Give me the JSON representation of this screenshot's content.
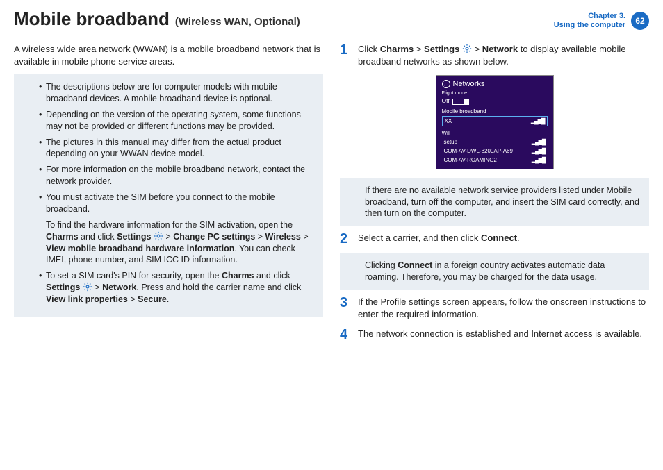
{
  "header": {
    "title_main": "Mobile broadband",
    "title_sub": "(Wireless WAN, Optional)",
    "chapter_line1": "Chapter 3.",
    "chapter_line2": "Using the computer",
    "page": "62"
  },
  "left": {
    "intro": "A wireless wide area network (WWAN) is a mobile broadband network that is available in mobile phone service areas.",
    "notes": {
      "b1": "The descriptions below are for computer models with mobile broadband devices. A mobile broadband device is optional.",
      "b2": "Depending on the version of the operating system, some functions may not be provided or different functions may be provided.",
      "b3": "The pictures in this manual may differ from the actual product depending on your WWAN device model.",
      "b4": "For more information on the mobile broadband network, contact the network provider.",
      "b5": "You must activate the SIM before you connect to the mobile broadband.",
      "sub1_a": "To find the hardware information for the SIM activation, open the ",
      "sub1_charms": "Charms",
      "sub1_andclick": " and click ",
      "sub1_settings": "Settings",
      "sub1_gt1": " > ",
      "sub1_change": "Change PC settings",
      "sub1_gt2": " > ",
      "sub1_wireless": "Wireless",
      "sub1_gt3": " > ",
      "sub1_view": "View mobile broadband hardware information",
      "sub1_tail": ". You can check IMEI, phone number, and SIM ICC ID information.",
      "b6_a": "To set a SIM card's PIN for security, open the ",
      "b6_charms": "Charms",
      "b6_andclick": " and click ",
      "b6_settings": "Settings",
      "b6_gt1": " > ",
      "b6_network": "Network",
      "b6_tail": ". Press and hold the carrier name and click ",
      "b6_view": "View link properties",
      "b6_gt2": " > ",
      "b6_secure": "Secure",
      "b6_dot": "."
    }
  },
  "right": {
    "step1": {
      "num": "1",
      "a": "Click ",
      "charms": "Charms",
      "gt1": " > ",
      "settings": "Settings",
      "gt2": " > ",
      "network": "Network",
      "tail": " to display available mobile broadband networks as shown below."
    },
    "screenshot": {
      "title": "Networks",
      "flight": "Flight mode",
      "off": "Off",
      "mb": "Mobile broadband",
      "xx": "XX",
      "wifi": "WiFi",
      "setup": "setup",
      "ap1": "COM-AV-DWL-8200AP-A69",
      "ap2": "COM-AV-ROAMING2"
    },
    "note1": "If there are no available network service providers listed under Mobile broadband, turn off the computer, and insert the SIM card correctly, and then turn on the computer.",
    "step2": {
      "num": "2",
      "a": "Select a carrier, and then click ",
      "connect": "Connect",
      "dot": "."
    },
    "note2_a": "Clicking ",
    "note2_connect": "Connect",
    "note2_b": " in a foreign country activates automatic data roaming. Therefore, you may be charged for the data usage.",
    "step3": {
      "num": "3",
      "text": "If the Profile settings screen appears, follow the onscreen instructions to enter the required information."
    },
    "step4": {
      "num": "4",
      "text": "The network connection is established and Internet access is available."
    }
  }
}
